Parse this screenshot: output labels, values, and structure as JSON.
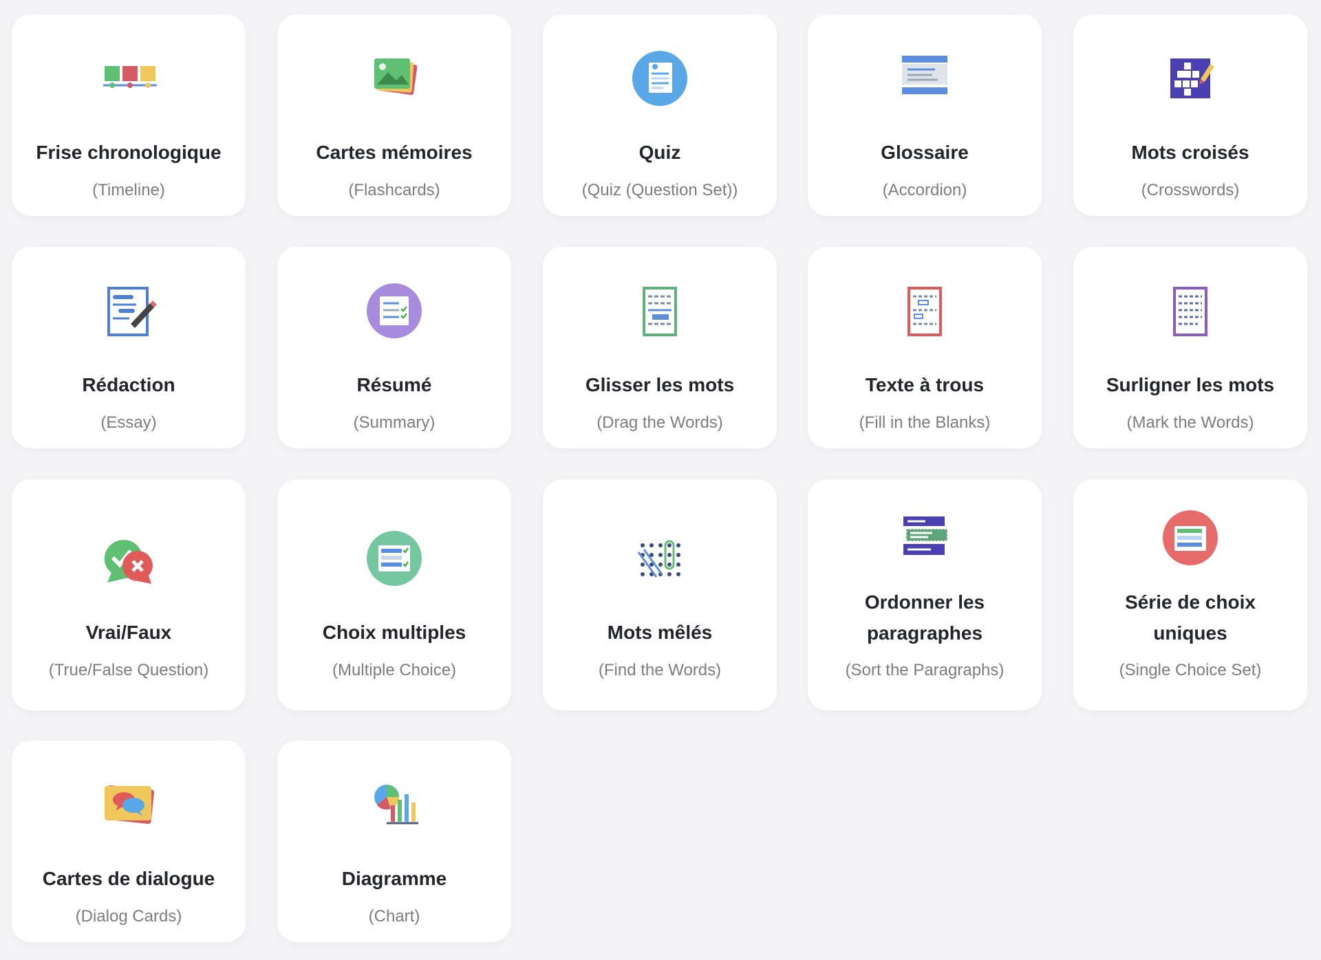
{
  "cards": [
    {
      "title": "Frise chronologique",
      "subtitle": "(Timeline)",
      "icon": "timeline-icon"
    },
    {
      "title": "Cartes mémoires",
      "subtitle": "(Flashcards)",
      "icon": "flashcards-icon"
    },
    {
      "title": "Quiz",
      "subtitle": "(Quiz (Question Set))",
      "icon": "quiz-icon"
    },
    {
      "title": "Glossaire",
      "subtitle": "(Accordion)",
      "icon": "accordion-icon"
    },
    {
      "title": "Mots croisés",
      "subtitle": "(Crosswords)",
      "icon": "crossword-icon"
    },
    {
      "title": "Rédaction",
      "subtitle": "(Essay)",
      "icon": "essay-icon"
    },
    {
      "title": "Résumé",
      "subtitle": "(Summary)",
      "icon": "summary-icon"
    },
    {
      "title": "Glisser les mots",
      "subtitle": "(Drag the Words)",
      "icon": "drag-words-icon"
    },
    {
      "title": "Texte à trous",
      "subtitle": "(Fill in the Blanks)",
      "icon": "fill-blanks-icon"
    },
    {
      "title": "Surligner les mots",
      "subtitle": "(Mark the Words)",
      "icon": "mark-words-icon"
    },
    {
      "title": "Vrai/Faux",
      "subtitle": "(True/False Question)",
      "icon": "true-false-icon"
    },
    {
      "title": "Choix multiples",
      "subtitle": "(Multiple Choice)",
      "icon": "multiple-choice-icon"
    },
    {
      "title": "Mots mêlés",
      "subtitle": "(Find the Words)",
      "icon": "find-words-icon"
    },
    {
      "title": "Ordonner les paragraphes",
      "subtitle": "(Sort the Paragraphs)",
      "icon": "sort-paragraphs-icon"
    },
    {
      "title": "Série de choix uniques",
      "subtitle": "(Single Choice Set)",
      "icon": "single-choice-icon"
    },
    {
      "title": "Cartes de dialogue",
      "subtitle": "(Dialog Cards)",
      "icon": "dialog-cards-icon"
    },
    {
      "title": "Diagramme",
      "subtitle": "(Chart)",
      "icon": "chart-icon"
    }
  ]
}
